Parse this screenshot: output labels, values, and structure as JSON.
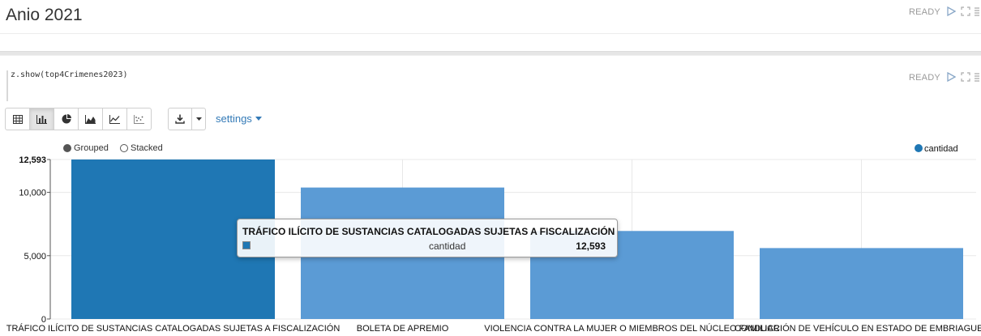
{
  "paragraph1": {
    "title": "Anio 2021",
    "status": "READY"
  },
  "paragraph2": {
    "code": "z.show(top4Crimenes2023)",
    "status": "READY",
    "toolbar": {
      "view_buttons": [
        {
          "name": "table-view-button",
          "icon": "table-icon"
        },
        {
          "name": "bar-chart-view-button",
          "icon": "bar-chart-icon",
          "active": true
        },
        {
          "name": "pie-chart-view-button",
          "icon": "pie-chart-icon"
        },
        {
          "name": "area-chart-view-button",
          "icon": "area-chart-icon"
        },
        {
          "name": "line-chart-view-button",
          "icon": "line-chart-icon"
        },
        {
          "name": "scatter-chart-view-button",
          "icon": "scatter-chart-icon"
        }
      ],
      "download_icon": "download-icon",
      "settings_label": "settings"
    },
    "chart_mode": {
      "grouped_label": "Grouped",
      "stacked_label": "Stacked",
      "selected": "Grouped"
    },
    "tooltip": {
      "title": "TRÁFICO ILÍCITO DE SUSTANCIAS CATALOGADAS SUJETAS A FISCALIZACIÓN",
      "series": "cantidad",
      "value": "12,593"
    }
  },
  "chart_data": {
    "type": "bar",
    "categories": [
      "TRÁFICO ILÍCITO DE SUSTANCIAS CATALOGADAS SUJETAS A FISCALIZACIÓN",
      "BOLETA DE APREMIO",
      "VIOLENCIA CONTRA LA MUJER O MIEMBROS DEL NÚCLEO FAMILIAR",
      "CONDUCCIÓN DE VEHÍCULO EN ESTADO DE EMBRIAGUEZ"
    ],
    "series": [
      {
        "name": "cantidad",
        "values": [
          12593,
          10380,
          6950,
          5600
        ],
        "color": "#1f77b4"
      }
    ],
    "highlight_index": 0,
    "yticks": [
      0,
      5000,
      10000,
      12593
    ],
    "ytick_labels": [
      "0",
      "5,000",
      "10,000",
      "12,593"
    ],
    "ylim": [
      0,
      12593
    ],
    "grid": true,
    "legend_position": "top-right",
    "bar_color": "#5b9bd5",
    "highlight_color": "#1f77b4"
  }
}
